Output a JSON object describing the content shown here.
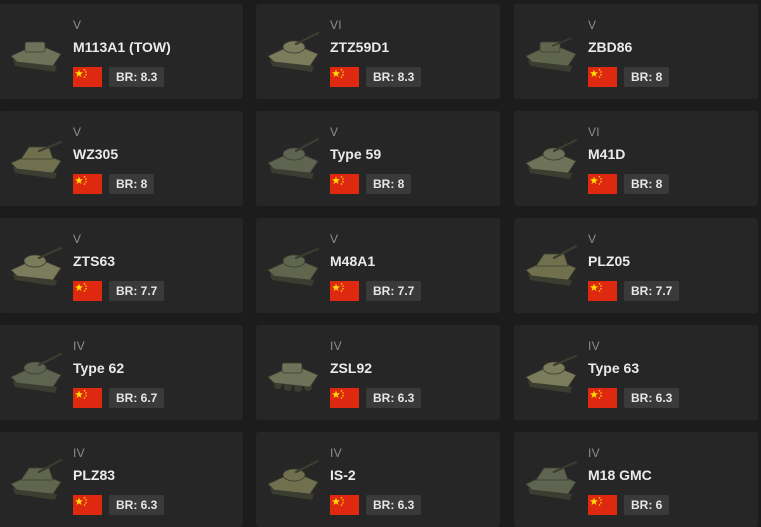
{
  "br_prefix": "BR: ",
  "cards": [
    {
      "rank": "V",
      "name": "M113A1 (TOW)",
      "br": "8.3",
      "flag": "china-flag-icon",
      "icon": "apc-icon"
    },
    {
      "rank": "VI",
      "name": "ZTZ59D1",
      "br": "8.3",
      "flag": "china-flag-icon",
      "icon": "tank-icon"
    },
    {
      "rank": "V",
      "name": "ZBD86",
      "br": "8",
      "flag": "china-flag-icon",
      "icon": "ifv-icon"
    },
    {
      "rank": "V",
      "name": "WZ305",
      "br": "8",
      "flag": "china-flag-icon",
      "icon": "tank-destroyer-icon"
    },
    {
      "rank": "V",
      "name": "Type 59",
      "br": "8",
      "flag": "china-flag-icon",
      "icon": "tank-icon"
    },
    {
      "rank": "VI",
      "name": "M41D",
      "br": "8",
      "flag": "china-flag-icon",
      "icon": "light-tank-icon"
    },
    {
      "rank": "V",
      "name": "ZTS63",
      "br": "7.7",
      "flag": "china-flag-icon",
      "icon": "light-tank-icon"
    },
    {
      "rank": "V",
      "name": "M48A1",
      "br": "7.7",
      "flag": "china-flag-icon",
      "icon": "tank-icon"
    },
    {
      "rank": "V",
      "name": "PLZ05",
      "br": "7.7",
      "flag": "china-flag-icon",
      "icon": "spg-icon"
    },
    {
      "rank": "IV",
      "name": "Type 62",
      "br": "6.7",
      "flag": "china-flag-icon",
      "icon": "light-tank-icon"
    },
    {
      "rank": "IV",
      "name": "ZSL92",
      "br": "6.3",
      "flag": "china-flag-icon",
      "icon": "wheeled-apc-icon"
    },
    {
      "rank": "IV",
      "name": "Type 63",
      "br": "6.3",
      "flag": "china-flag-icon",
      "icon": "light-tank-icon"
    },
    {
      "rank": "IV",
      "name": "PLZ83",
      "br": "6.3",
      "flag": "china-flag-icon",
      "icon": "spg-icon"
    },
    {
      "rank": "IV",
      "name": "IS-2",
      "br": "6.3",
      "flag": "china-flag-icon",
      "icon": "heavy-tank-icon"
    },
    {
      "rank": "IV",
      "name": "M18 GMC",
      "br": "6",
      "flag": "china-flag-icon",
      "icon": "tank-destroyer-icon"
    }
  ],
  "colors": {
    "background": "#1c1c1c",
    "card": "#262626",
    "br_badge": "#3a3a3a",
    "rank_text": "#8d8d8d",
    "name_text": "#eaeaea",
    "flag_red": "#de2910",
    "flag_star": "#ffde00"
  }
}
